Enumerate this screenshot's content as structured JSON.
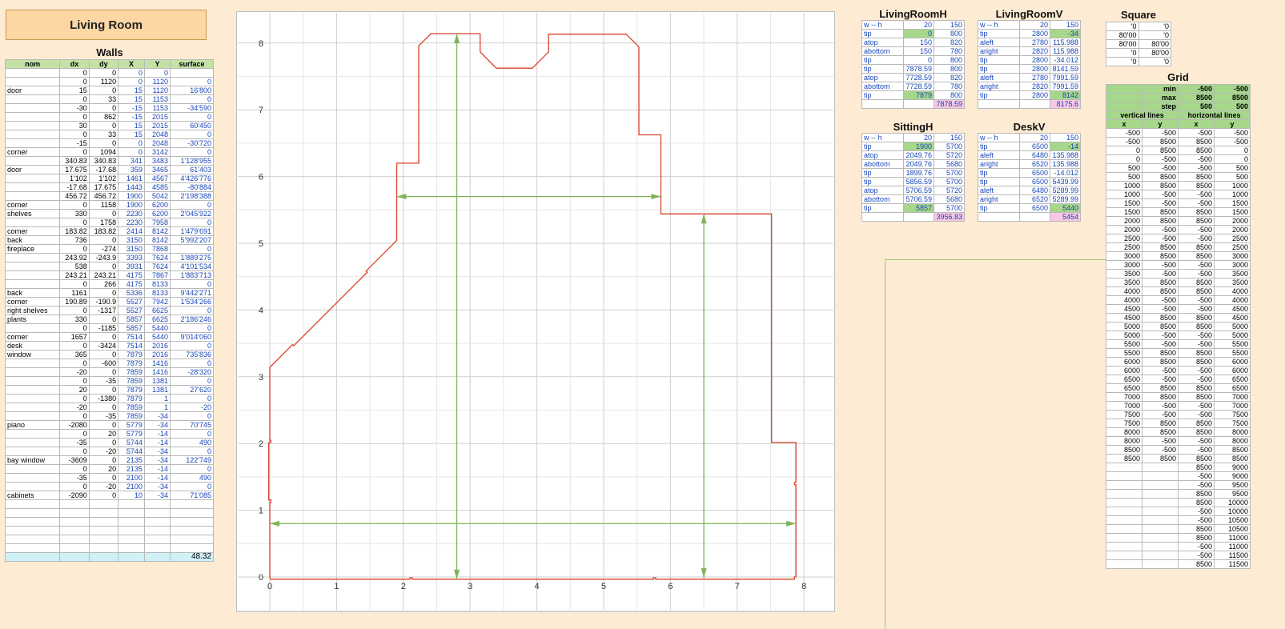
{
  "title": "Living Room",
  "walls": {
    "title": "Walls",
    "headers": [
      "nom",
      "dx",
      "dy",
      "X",
      "Y",
      "surface"
    ],
    "rows": [
      [
        "",
        "0",
        "0",
        "0",
        "0",
        ""
      ],
      [
        "",
        "0",
        "1120",
        "0",
        "1120",
        "0"
      ],
      [
        "door",
        "15",
        "0",
        "15",
        "1120",
        "16'800"
      ],
      [
        "",
        "0",
        "33",
        "15",
        "1153",
        "0"
      ],
      [
        "",
        "-30",
        "0",
        "-15",
        "1153",
        "-34'590"
      ],
      [
        "",
        "0",
        "862",
        "-15",
        "2015",
        "0"
      ],
      [
        "",
        "30",
        "0",
        "15",
        "2015",
        "60'450"
      ],
      [
        "",
        "0",
        "33",
        "15",
        "2048",
        "0"
      ],
      [
        "",
        "-15",
        "0",
        "0",
        "2048",
        "-30'720"
      ],
      [
        "corner",
        "0",
        "1094",
        "0",
        "3142",
        "0"
      ],
      [
        "",
        "340.83",
        "340.83",
        "341",
        "3483",
        "1'128'955"
      ],
      [
        "door",
        "17.675",
        "-17.68",
        "359",
        "3465",
        "61'403"
      ],
      [
        "",
        "1'102",
        "1'102",
        "1461",
        "4567",
        "4'426'776"
      ],
      [
        "",
        "-17.68",
        "17.675",
        "1443",
        "4585",
        "-80'884"
      ],
      [
        "",
        "456.72",
        "456.72",
        "1900",
        "5042",
        "2'198'388"
      ],
      [
        "corner",
        "0",
        "1158",
        "1900",
        "6200",
        "0"
      ],
      [
        "shelves",
        "330",
        "0",
        "2230",
        "6200",
        "2'045'922"
      ],
      [
        "",
        "0",
        "1758",
        "2230",
        "7958",
        "0"
      ],
      [
        "corner",
        "183.82",
        "183.82",
        "2414",
        "8142",
        "1'479'691"
      ],
      [
        "back",
        "736",
        "0",
        "3150",
        "8142",
        "5'992'207"
      ],
      [
        "fireplace",
        "0",
        "-274",
        "3150",
        "7868",
        "0"
      ],
      [
        "",
        "243.92",
        "-243.9",
        "3393",
        "7624",
        "1'889'275"
      ],
      [
        "",
        "538",
        "0",
        "3931",
        "7624",
        "4'101'534"
      ],
      [
        "",
        "243.21",
        "243.21",
        "4175",
        "7867",
        "1'883'713"
      ],
      [
        "",
        "0",
        "266",
        "4175",
        "8133",
        "0"
      ],
      [
        "back",
        "1161",
        "0",
        "5336",
        "8133",
        "9'442'271"
      ],
      [
        "corner",
        "190.89",
        "-190.9",
        "5527",
        "7942",
        "1'534'266"
      ],
      [
        "right shelves",
        "0",
        "-1317",
        "5527",
        "6625",
        "0"
      ],
      [
        "plants",
        "330",
        "0",
        "5857",
        "6625",
        "2'186'246"
      ],
      [
        "",
        "0",
        "-1185",
        "5857",
        "5440",
        "0"
      ],
      [
        "corner",
        "1657",
        "0",
        "7514",
        "5440",
        "9'014'060"
      ],
      [
        "desk",
        "0",
        "-3424",
        "7514",
        "2016",
        "0"
      ],
      [
        "window",
        "365",
        "0",
        "7879",
        "2016",
        "735'836"
      ],
      [
        "",
        "0",
        "-600",
        "7879",
        "1416",
        "0"
      ],
      [
        "",
        "-20",
        "0",
        "7859",
        "1416",
        "-28'320"
      ],
      [
        "",
        "0",
        "-35",
        "7859",
        "1381",
        "0"
      ],
      [
        "",
        "20",
        "0",
        "7879",
        "1381",
        "27'620"
      ],
      [
        "",
        "0",
        "-1380",
        "7879",
        "1",
        "0"
      ],
      [
        "",
        "-20",
        "0",
        "7859",
        "1",
        "-20"
      ],
      [
        "",
        "0",
        "-35",
        "7859",
        "-34",
        "0"
      ],
      [
        "piano",
        "-2080",
        "0",
        "5779",
        "-34",
        "70'745"
      ],
      [
        "",
        "0",
        "20",
        "5779",
        "-14",
        "0"
      ],
      [
        "",
        "-35",
        "0",
        "5744",
        "-14",
        "490"
      ],
      [
        "",
        "0",
        "-20",
        "5744",
        "-34",
        "0"
      ],
      [
        "bay window",
        "-3609",
        "0",
        "2135",
        "-34",
        "122'749"
      ],
      [
        "",
        "0",
        "20",
        "2135",
        "-14",
        "0"
      ],
      [
        "",
        "-35",
        "0",
        "2100",
        "-14",
        "490"
      ],
      [
        "",
        "0",
        "-20",
        "2100",
        "-34",
        "0"
      ],
      [
        "cabinets",
        "-2090",
        "0",
        "10",
        "-34",
        "71'085"
      ],
      [
        "",
        "",
        "",
        "",
        "",
        ""
      ],
      [
        "",
        "",
        "",
        "",
        "",
        ""
      ],
      [
        "",
        "",
        "",
        "",
        "",
        ""
      ],
      [
        "",
        "",
        "",
        "",
        "",
        ""
      ],
      [
        "",
        "",
        "",
        "",
        "",
        ""
      ],
      [
        "",
        "",
        "",
        "",
        "",
        ""
      ]
    ],
    "total": "48.32"
  },
  "dims": {
    "living_room_h": {
      "title": "LivingRoomH",
      "rows": [
        [
          "w -- h",
          "20",
          "150"
        ],
        [
          "tip",
          "0",
          "800"
        ],
        [
          "atop",
          "150",
          "820"
        ],
        [
          "abottom",
          "150",
          "780"
        ],
        [
          "tip",
          "0",
          "800"
        ],
        [
          "tip",
          "7878.59",
          "800"
        ],
        [
          "atop",
          "7728.59",
          "820"
        ],
        [
          "abottom",
          "7728.59",
          "780"
        ],
        [
          "tip",
          "7879",
          "800"
        ],
        [
          "",
          "",
          "7878.59"
        ]
      ]
    },
    "living_room_v": {
      "title": "LivingRoomV",
      "rows": [
        [
          "w -- h",
          "20",
          "150"
        ],
        [
          "tip",
          "2800",
          "-34"
        ],
        [
          "aleft",
          "2780",
          "115.988"
        ],
        [
          "aright",
          "2820",
          "115.988"
        ],
        [
          "tip",
          "2800",
          "-34.012"
        ],
        [
          "tip",
          "2800",
          "8141.59"
        ],
        [
          "aleft",
          "2780",
          "7991.59"
        ],
        [
          "aright",
          "2820",
          "7991.59"
        ],
        [
          "tip",
          "2800",
          "8142"
        ],
        [
          "",
          "",
          "8175.6"
        ]
      ]
    },
    "sitting_h": {
      "title": "SittingH",
      "rows": [
        [
          "w -- h",
          "20",
          "150"
        ],
        [
          "tip",
          "1900",
          "5700"
        ],
        [
          "atop",
          "2049.76",
          "5720"
        ],
        [
          "abottom",
          "2049.76",
          "5680"
        ],
        [
          "tip",
          "1899.76",
          "5700"
        ],
        [
          "tip",
          "5856.59",
          "5700"
        ],
        [
          "atop",
          "5706.59",
          "5720"
        ],
        [
          "abottom",
          "5706.59",
          "5680"
        ],
        [
          "tip",
          "5857",
          "5700"
        ],
        [
          "",
          "",
          "3956.83"
        ]
      ]
    },
    "desk_v": {
      "title": "DeskV",
      "rows": [
        [
          "w -- h",
          "20",
          "150"
        ],
        [
          "tip",
          "6500",
          "-14"
        ],
        [
          "aleft",
          "6480",
          "135.988"
        ],
        [
          "aright",
          "6520",
          "135.988"
        ],
        [
          "tip",
          "6500",
          "-14.012"
        ],
        [
          "tip",
          "6500",
          "5439.99"
        ],
        [
          "aleft",
          "6480",
          "5289.99"
        ],
        [
          "aright",
          "6520",
          "5289.99"
        ],
        [
          "tip",
          "6500",
          "5440"
        ],
        [
          "",
          "",
          "5454"
        ]
      ]
    }
  },
  "square": {
    "title": "Square",
    "rows": [
      [
        "'0",
        "'0"
      ],
      [
        "80'00",
        "'0"
      ],
      [
        "80'00",
        "80'00"
      ],
      [
        "'0",
        "80'00"
      ],
      [
        "'0",
        "'0"
      ]
    ]
  },
  "grid": {
    "title": "Grid",
    "params": [
      [
        "min",
        "-500",
        "-500"
      ],
      [
        "max",
        "8500",
        "8500"
      ],
      [
        "step",
        "500",
        "500"
      ]
    ],
    "group_headers": [
      "vertical lines",
      "horizontal lines"
    ],
    "col_headers": [
      "x",
      "y",
      "x",
      "y"
    ],
    "rows": [
      [
        "-500",
        "-500",
        "-500",
        "-500"
      ],
      [
        "-500",
        "8500",
        "8500",
        "-500"
      ],
      [
        "0",
        "8500",
        "8500",
        "0"
      ],
      [
        "0",
        "-500",
        "-500",
        "0"
      ],
      [
        "500",
        "-500",
        "-500",
        "500"
      ],
      [
        "500",
        "8500",
        "8500",
        "500"
      ],
      [
        "1000",
        "8500",
        "8500",
        "1000"
      ],
      [
        "1000",
        "-500",
        "-500",
        "1000"
      ],
      [
        "1500",
        "-500",
        "-500",
        "1500"
      ],
      [
        "1500",
        "8500",
        "8500",
        "1500"
      ],
      [
        "2000",
        "8500",
        "8500",
        "2000"
      ],
      [
        "2000",
        "-500",
        "-500",
        "2000"
      ],
      [
        "2500",
        "-500",
        "-500",
        "2500"
      ],
      [
        "2500",
        "8500",
        "8500",
        "2500"
      ],
      [
        "3000",
        "8500",
        "8500",
        "3000"
      ],
      [
        "3000",
        "-500",
        "-500",
        "3000"
      ],
      [
        "3500",
        "-500",
        "-500",
        "3500"
      ],
      [
        "3500",
        "8500",
        "8500",
        "3500"
      ],
      [
        "4000",
        "8500",
        "8500",
        "4000"
      ],
      [
        "4000",
        "-500",
        "-500",
        "4000"
      ],
      [
        "4500",
        "-500",
        "-500",
        "4500"
      ],
      [
        "4500",
        "8500",
        "8500",
        "4500"
      ],
      [
        "5000",
        "8500",
        "8500",
        "5000"
      ],
      [
        "5000",
        "-500",
        "-500",
        "5000"
      ],
      [
        "5500",
        "-500",
        "-500",
        "5500"
      ],
      [
        "5500",
        "8500",
        "8500",
        "5500"
      ],
      [
        "6000",
        "8500",
        "8500",
        "6000"
      ],
      [
        "6000",
        "-500",
        "-500",
        "6000"
      ],
      [
        "6500",
        "-500",
        "-500",
        "6500"
      ],
      [
        "6500",
        "8500",
        "8500",
        "6500"
      ],
      [
        "7000",
        "8500",
        "8500",
        "7000"
      ],
      [
        "7000",
        "-500",
        "-500",
        "7000"
      ],
      [
        "7500",
        "-500",
        "-500",
        "7500"
      ],
      [
        "7500",
        "8500",
        "8500",
        "7500"
      ],
      [
        "8000",
        "8500",
        "8500",
        "8000"
      ],
      [
        "8000",
        "-500",
        "-500",
        "8000"
      ],
      [
        "8500",
        "-500",
        "-500",
        "8500"
      ],
      [
        "8500",
        "8500",
        "8500",
        "8500"
      ],
      [
        "",
        "",
        "8500",
        "9000"
      ],
      [
        "",
        "",
        "-500",
        "9000"
      ],
      [
        "",
        "",
        "-500",
        "9500"
      ],
      [
        "",
        "",
        "8500",
        "9500"
      ],
      [
        "",
        "",
        "8500",
        "10000"
      ],
      [
        "",
        "",
        "-500",
        "10000"
      ],
      [
        "",
        "",
        "-500",
        "10500"
      ],
      [
        "",
        "",
        "8500",
        "10500"
      ],
      [
        "",
        "",
        "8500",
        "11000"
      ],
      [
        "",
        "",
        "-500",
        "11000"
      ],
      [
        "",
        "",
        "-500",
        "11500"
      ],
      [
        "",
        "",
        "8500",
        "11500"
      ]
    ]
  },
  "chart_data": {
    "type": "line",
    "xlim": [
      0,
      8
    ],
    "ylim": [
      0,
      8
    ],
    "x_ticks": [
      "0",
      "1",
      "2",
      "3",
      "4",
      "5",
      "6",
      "7",
      "8"
    ],
    "y_ticks": [
      "0",
      "1",
      "2",
      "3",
      "4",
      "5",
      "6",
      "7",
      "8"
    ],
    "grid": true,
    "series": [
      {
        "color": "#d9402b",
        "points": [
          [
            0,
            0
          ],
          [
            0,
            1.12
          ],
          [
            0.015,
            1.12
          ],
          [
            0.015,
            1.153
          ],
          [
            -0.015,
            1.153
          ],
          [
            -0.015,
            2.015
          ],
          [
            0.015,
            2.015
          ],
          [
            0.015,
            2.048
          ],
          [
            0,
            2.048
          ],
          [
            0,
            3.142
          ],
          [
            0.341,
            3.483
          ],
          [
            0.359,
            3.465
          ],
          [
            1.461,
            4.567
          ],
          [
            1.443,
            4.585
          ],
          [
            1.9,
            5.042
          ],
          [
            1.9,
            6.2
          ],
          [
            2.23,
            6.2
          ],
          [
            2.23,
            7.958
          ],
          [
            2.414,
            8.142
          ],
          [
            3.15,
            8.142
          ],
          [
            3.15,
            7.868
          ],
          [
            3.393,
            7.624
          ],
          [
            3.931,
            7.624
          ],
          [
            4.175,
            7.867
          ],
          [
            4.175,
            8.133
          ],
          [
            5.336,
            8.133
          ],
          [
            5.527,
            7.942
          ],
          [
            5.527,
            6.625
          ],
          [
            5.857,
            6.625
          ],
          [
            5.857,
            5.44
          ],
          [
            7.514,
            5.44
          ],
          [
            7.514,
            2.016
          ],
          [
            7.879,
            2.016
          ],
          [
            7.879,
            1.416
          ],
          [
            7.859,
            1.416
          ],
          [
            7.859,
            1.381
          ],
          [
            7.879,
            1.381
          ],
          [
            7.879,
            0.001
          ],
          [
            7.859,
            0.001
          ],
          [
            7.859,
            -0.034
          ],
          [
            5.779,
            -0.034
          ],
          [
            5.779,
            -0.014
          ],
          [
            5.744,
            -0.014
          ],
          [
            5.744,
            -0.034
          ],
          [
            2.135,
            -0.034
          ],
          [
            2.135,
            -0.014
          ],
          [
            2.1,
            -0.014
          ],
          [
            2.1,
            -0.034
          ],
          [
            0.01,
            -0.034
          ],
          [
            0,
            0
          ]
        ]
      }
    ],
    "dimension_arrows": [
      {
        "name": "LivingRoomH",
        "color": "#7fb35a",
        "from": [
          0,
          0.8
        ],
        "to": [
          7.879,
          0.8
        ]
      },
      {
        "name": "LivingRoomV",
        "color": "#7fb35a",
        "from": [
          2.8,
          -0.034
        ],
        "to": [
          2.8,
          8.142
        ]
      },
      {
        "name": "SittingH",
        "color": "#7fb35a",
        "from": [
          1.9,
          5.7
        ],
        "to": [
          5.857,
          5.7
        ]
      },
      {
        "name": "DeskV",
        "color": "#7fb35a",
        "from": [
          6.5,
          -0.014
        ],
        "to": [
          6.5,
          5.44
        ]
      }
    ]
  }
}
